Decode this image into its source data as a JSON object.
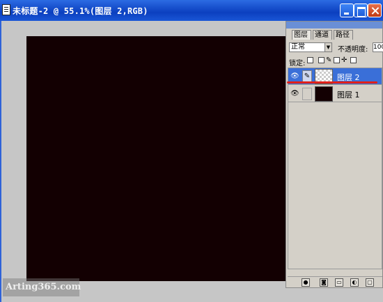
{
  "window": {
    "title": "未标题-2 @ 55.1%(图层 2,RGB)"
  },
  "canvas": {
    "fill_color": "#130002"
  },
  "watermark": {
    "text": "Arting365.com"
  },
  "layers_panel": {
    "tabs": [
      {
        "label": "图层",
        "active": true
      },
      {
        "label": "通道",
        "active": false
      },
      {
        "label": "路径",
        "active": false
      }
    ],
    "blend_mode": "正常",
    "opacity_label": "不透明度:",
    "opacity_value": "100",
    "lock_label": "锁定:",
    "layers": [
      {
        "name": "图层 2",
        "selected": true,
        "thumbnail": "transparent-checker",
        "visible_icon": "eye-icon",
        "link_icon": "brush-icon"
      },
      {
        "name": "图层 1",
        "selected": false,
        "thumbnail": "dark-fill",
        "visible_icon": "eye-icon",
        "link_icon": ""
      }
    ],
    "annotation_color": "#e0201a"
  },
  "colors": {
    "titlebar": "#0b3fbf",
    "workspace": "#c6c6c6",
    "panel": "#d4d0c8",
    "selection": "#3a6fd8"
  }
}
